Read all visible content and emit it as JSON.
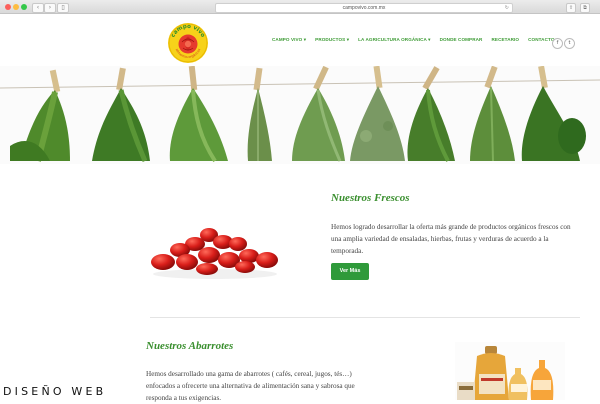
{
  "browser": {
    "url": "campovivo.com.mx",
    "back_icon": "chevron-left-icon",
    "forward_icon": "chevron-right-icon"
  },
  "header": {
    "logo_text_top": "campo vivo",
    "logo_text_bottom": "alimentos orgánicos",
    "nav": [
      {
        "label": "CAMPO VIVO",
        "dropdown": true
      },
      {
        "label": "PRODUCTOS",
        "dropdown": true
      },
      {
        "label": "LA AGRICULTURA ORGÁNICA",
        "dropdown": true
      },
      {
        "label": "DONDE COMPRAR",
        "dropdown": false
      },
      {
        "label": "RECETARIO",
        "dropdown": false
      },
      {
        "label": "CONTACTO",
        "dropdown": false
      }
    ],
    "social": {
      "facebook": "f",
      "twitter": "t"
    }
  },
  "frescos": {
    "title": "Nuestros Frescos",
    "text": "Hemos logrado desarrollar la oferta más grande de productos orgánicos frescos con una amplia variedad de ensaladas, hierbas, frutas y verduras de acuerdo a la temporada.",
    "button": "Ver Más"
  },
  "abarrotes": {
    "title": "Nuestros Abarrotes",
    "text": "Hemos desarrollado una gama de abarrotes ( cafés, cereal, jugos, tés…) enfocados a ofrecerte una alternativa de alimentación sana y sabrosa que responda a tus exigencias."
  },
  "caption": "DISEÑO WEB",
  "colors": {
    "accent": "#3a8f2f",
    "button": "#2f9a3a"
  }
}
